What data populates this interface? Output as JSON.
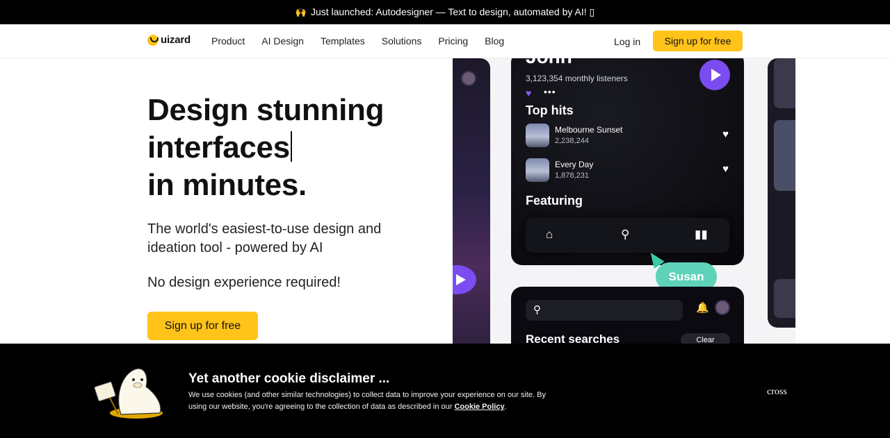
{
  "announcement": {
    "emoji": "🙌",
    "text": "Just launched: Autodesigner — Text to design, automated by AI! ▯"
  },
  "nav": {
    "logo_text": "uizard",
    "links": [
      "Product",
      "AI Design",
      "Templates",
      "Solutions",
      "Pricing",
      "Blog"
    ],
    "login": "Log in",
    "signup": "Sign up for free"
  },
  "hero": {
    "title_line1": "Design stunning",
    "title_line2": "interfaces",
    "title_line3": "in minutes.",
    "subtitle": "The world's easiest-to-use design and ideation tool - powered by AI",
    "note": "No design experience required!",
    "cta": "Sign up for free"
  },
  "illustration": {
    "artist": "John",
    "listeners": "3,123,354 monthly listeners",
    "top_hits_title": "Top hits",
    "tracks": [
      {
        "name": "Melbourne Sunset",
        "plays": "2,238,244"
      },
      {
        "name": "Every Day",
        "plays": "1,878,231"
      }
    ],
    "featuring_title": "Featuring",
    "cursor_label": "Susan",
    "recent_title": "Recent searches",
    "clear_label": "Clear",
    "accent": "#7b4cf0",
    "cursor_color": "#5ed3ba"
  },
  "cookie": {
    "title": "Yet another cookie disclaimer ...",
    "text": "We use cookies (and other similar technologies) to collect data to improve your experience on our site. By using our website, you're agreeing to the collection of data as described in our ",
    "link": "Cookie Policy",
    "text_end": ".",
    "close": "cross"
  },
  "colors": {
    "brand_yellow": "#ffc31a",
    "announcement_bg": "#000000",
    "cookie_bg": "#000000"
  }
}
